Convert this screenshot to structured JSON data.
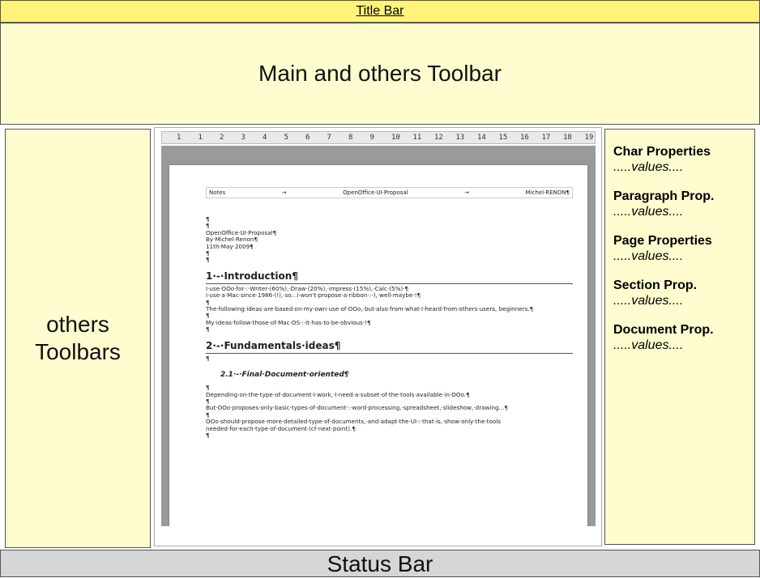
{
  "title_bar": {
    "label": "Title Bar"
  },
  "main_toolbar": {
    "label": "Main and others Toolbar"
  },
  "others_toolbars": {
    "line1": "others",
    "line2": "Toolbars"
  },
  "ruler": {
    "ticks": [
      "1",
      "1",
      "2",
      "3",
      "4",
      "5",
      "6",
      "7",
      "8",
      "9",
      "10",
      "11",
      "12",
      "13",
      "14",
      "15",
      "16",
      "17",
      "18",
      "19"
    ]
  },
  "document": {
    "header": {
      "left": "Notes",
      "arrow1": "→",
      "center": "OpenOffice·UI·Proposal",
      "arrow2": "→",
      "right": "Michel·RENON¶"
    },
    "lines": {
      "l1": "¶",
      "l2": "¶",
      "l3": "OpenOffice·UI·Proposal¶",
      "l4": "By·Michel·Renon¶",
      "l5": "11th·May·2009¶",
      "l6": "¶",
      "l7": "¶",
      "h1": "1·-·Introduction¶",
      "l8": "I·use·OOo·for·:·Writer·(60%),·Draw·(20%),·impress·(15%),·Calc·(5%)·¶",
      "l9": "I·use·a·Mac·since·1986·(!),·so...i·won't·propose·a·ribbon·:-),·well·maybe·!¶",
      "l10": "¶",
      "l11": "The·following·ideas·are·based·on·my·own·use·of·OOo,·but·also·from·what·I·heard·from·others·users, beginners.¶",
      "l12": "¶",
      "l13": "My·ideas·follow·those·of·Mac·OS·:·it·has·to·be·obvious·!¶",
      "l14": "¶",
      "h2": "2·-·Fundamentals·ideas¶",
      "l15": "¶",
      "h3": "2.1·-·Final·Document·oriented¶",
      "l16": "¶",
      "l17": "Depending·on·the·type·of·document·I·work,·I·need·a·subset·of·the·tools·available·in·OOo.¶",
      "l18": "¶",
      "l19": "But·OOo·proposes·only·basic·types·of·document·:·word·processing,·spreadsheet,·slideshow,·drawing...¶",
      "l20": "¶",
      "l21": "OOo·should·propose·more·detailed·type·of·documents,·and·adapt·the·UI·:·that·is,·show·only·the·tools needed·for·each·type·of·document·(cf·next·point).¶",
      "l22": "¶"
    }
  },
  "right_panel": {
    "char": {
      "title": "Char Properties",
      "value": ".....values...."
    },
    "para": {
      "title": "Paragraph Prop.",
      "value": ".....values...."
    },
    "page": {
      "title": "Page Properties",
      "value": ".....values...."
    },
    "section": {
      "title": "Section Prop.",
      "value": ".....values...."
    },
    "document": {
      "title": "Document Prop.",
      "value": ".....values...."
    }
  },
  "status_bar": {
    "label": "Status Bar"
  },
  "colors": {
    "yellow": "#fffdcf",
    "title_yellow": "#fff37a",
    "status_gray": "#d6d6d6"
  }
}
